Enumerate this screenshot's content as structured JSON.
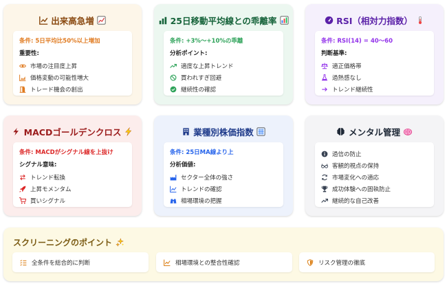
{
  "cards": [
    {
      "title": "出来高急増",
      "title_color": "#8a4a12",
      "accent": "#e07a1f",
      "icons": [
        "chart-line-icon",
        "chart-emoji-icon"
      ],
      "condition": "条件: 5日平均比50%以上増加",
      "subheading": "重要性:",
      "items": [
        {
          "icon": "eye-icon",
          "label": "市場の注目度上昇"
        },
        {
          "icon": "chart-area-icon",
          "label": "価格変動の可能性増大"
        },
        {
          "icon": "door-icon",
          "label": "トレード機会の創出"
        }
      ]
    },
    {
      "title": "25日移動平均線との乖離率",
      "title_color": "#16633a",
      "accent": "#2fa35a",
      "icons": [
        "bar-chart-icon",
        "bar-chart-emoji-icon"
      ],
      "condition": "条件: +3%～+10%の乖離",
      "subheading": "分析ポイント:",
      "items": [
        {
          "icon": "trend-up-icon",
          "label": "適度な上昇トレンド"
        },
        {
          "icon": "ban-icon",
          "label": "買われすぎ回避"
        },
        {
          "icon": "check-circle-icon",
          "label": "継続性の確認"
        }
      ]
    },
    {
      "title": "RSI（相対力指数）",
      "title_color": "#5b21a8",
      "accent": "#9333ea",
      "icons": [
        "gauge-icon",
        "thermometer-icon"
      ],
      "condition": "条件: RSI(14) = 40～60",
      "subheading": "判断基準:",
      "items": [
        {
          "icon": "balance-scale-icon",
          "label": "適正価格帯"
        },
        {
          "icon": "flask-icon",
          "label": "過熱感なし"
        },
        {
          "icon": "arrow-right-icon",
          "label": "トレンド継続性"
        }
      ]
    },
    {
      "title": "MACDゴールデンクロス",
      "title_color": "#9b1c1c",
      "accent": "#dc2626",
      "icons": [
        "bolt-icon",
        "bolt-emoji-icon"
      ],
      "condition": "条件: MACDがシグナル線を上抜け",
      "subheading": "シグナル意味:",
      "items": [
        {
          "icon": "exchange-icon",
          "label": "トレンド転換"
        },
        {
          "icon": "rocket-icon",
          "label": "上昇モメンタム"
        },
        {
          "icon": "cart-icon",
          "label": "買いシグナル"
        }
      ]
    },
    {
      "title": "業種別株価指数",
      "title_color": "#1e3a8a",
      "accent": "#2563eb",
      "icons": [
        "building-icon",
        "index-emoji-icon"
      ],
      "condition": "条件: 25日MA線より上",
      "subheading": "分析価値:",
      "items": [
        {
          "icon": "industry-icon",
          "label": "セクター全体の強さ"
        },
        {
          "icon": "chart-line-icon",
          "label": "トレンドの確認"
        },
        {
          "icon": "binoculars-icon",
          "label": "相場環境の把握"
        }
      ]
    },
    {
      "title": "メンタル管理",
      "title_color": "#1f2937",
      "accent": "#374151",
      "icons": [
        "brain-icon",
        "brain-emoji-icon"
      ],
      "condition": "",
      "subheading": "",
      "items": [
        {
          "icon": "info-circle-icon",
          "label": "過信の防止"
        },
        {
          "icon": "glasses-icon",
          "label": "客観的視点の保持"
        },
        {
          "icon": "sync-icon",
          "label": "市場変化への適応"
        },
        {
          "icon": "trophy-icon",
          "label": "成功体験への固執防止"
        },
        {
          "icon": "trend-up-icon",
          "label": "継続的な自己改善"
        }
      ]
    }
  ],
  "screening": {
    "title": "スクリーニングのポイント",
    "title_icon": "sparkle-icon",
    "points": [
      {
        "icon": "list-check-icon",
        "label": "全条件を総合的に判断"
      },
      {
        "icon": "chart-line-icon",
        "label": "相場環境との整合性確認"
      },
      {
        "icon": "shield-icon",
        "label": "リスク管理の徹底"
      }
    ]
  }
}
